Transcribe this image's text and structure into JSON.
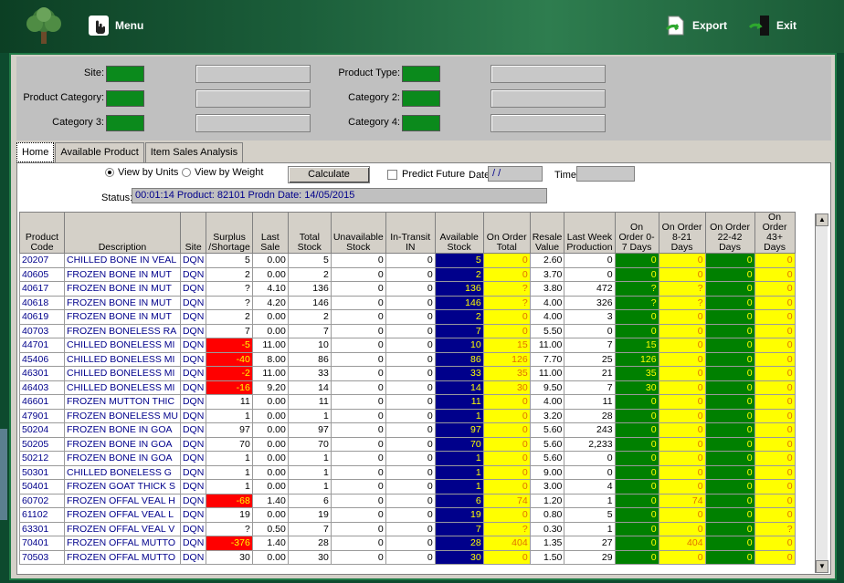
{
  "topbar": {
    "menu_label": "Menu",
    "export_label": "Export",
    "exit_label": "Exit"
  },
  "filters": {
    "site_label": "Site:",
    "product_category_label": "Product Category:",
    "category3_label": "Category 3:",
    "product_type_label": "Product Type:",
    "category2_label": "Category 2:",
    "category4_label": "Category 4:"
  },
  "tabs": [
    "Home",
    "Available Product",
    "Item Sales Analysis"
  ],
  "controls": {
    "view_units": "View by Units",
    "view_weight": "View by Weight",
    "calculate": "Calculate",
    "predict_future": "Predict Future",
    "date_label": "Date:",
    "date_value": " / /",
    "time_label": "Time:",
    "status_label": "Status:",
    "status_value": "00:01:14   Product: 82101   Prodn Date: 14/05/2015"
  },
  "table": {
    "headers": [
      "Product Code",
      "Description",
      "Site",
      "Surplus /Shortage",
      "Last Sale",
      "Total Stock",
      "Unavailable Stock",
      "In-Transit IN",
      "Available Stock",
      "On Order Total",
      "Resale Value",
      "Last Week Production",
      "On Order 0-7 Days",
      "On Order 8-21 Days",
      "On Order 22-42 Days",
      "On Order 43+ Days"
    ],
    "rows": [
      [
        "20207",
        "CHILLED BONE IN VEAL",
        "DQN",
        "5",
        "0.00",
        "5",
        "0",
        "0",
        "5",
        "0",
        "2.60",
        "0",
        "0",
        "0",
        "0",
        "0"
      ],
      [
        "40605",
        "FROZEN BONE IN MUT",
        "DQN",
        "2",
        "0.00",
        "2",
        "0",
        "0",
        "2",
        "0",
        "3.70",
        "0",
        "0",
        "0",
        "0",
        "0"
      ],
      [
        "40617",
        "FROZEN BONE IN MUT",
        "DQN",
        "?",
        "4.10",
        "136",
        "0",
        "0",
        "136",
        "?",
        "3.80",
        "472",
        "?",
        "?",
        "0",
        "0"
      ],
      [
        "40618",
        "FROZEN BONE IN MUT",
        "DQN",
        "?",
        "4.20",
        "146",
        "0",
        "0",
        "146",
        "?",
        "4.00",
        "326",
        "?",
        "?",
        "0",
        "0"
      ],
      [
        "40619",
        "FROZEN BONE IN MUT",
        "DQN",
        "2",
        "0.00",
        "2",
        "0",
        "0",
        "2",
        "0",
        "4.00",
        "3",
        "0",
        "0",
        "0",
        "0"
      ],
      [
        "40703",
        "FROZEN BONELESS RA",
        "DQN",
        "7",
        "0.00",
        "7",
        "0",
        "0",
        "7",
        "0",
        "5.50",
        "0",
        "0",
        "0",
        "0",
        "0"
      ],
      [
        "44701",
        "CHILLED BONELESS MI",
        "DQN",
        "-5",
        "11.00",
        "10",
        "0",
        "0",
        "10",
        "15",
        "11.00",
        "7",
        "15",
        "0",
        "0",
        "0"
      ],
      [
        "45406",
        "CHILLED BONELESS MI",
        "DQN",
        "-40",
        "8.00",
        "86",
        "0",
        "0",
        "86",
        "126",
        "7.70",
        "25",
        "126",
        "0",
        "0",
        "0"
      ],
      [
        "46301",
        "CHILLED BONELESS MI",
        "DQN",
        "-2",
        "11.00",
        "33",
        "0",
        "0",
        "33",
        "35",
        "11.00",
        "21",
        "35",
        "0",
        "0",
        "0"
      ],
      [
        "46403",
        "CHILLED BONELESS MI",
        "DQN",
        "-16",
        "9.20",
        "14",
        "0",
        "0",
        "14",
        "30",
        "9.50",
        "7",
        "30",
        "0",
        "0",
        "0"
      ],
      [
        "46601",
        "FROZEN MUTTON THIC",
        "DQN",
        "11",
        "0.00",
        "11",
        "0",
        "0",
        "11",
        "0",
        "4.00",
        "11",
        "0",
        "0",
        "0",
        "0"
      ],
      [
        "47901",
        "FROZEN BONELESS MU",
        "DQN",
        "1",
        "0.00",
        "1",
        "0",
        "0",
        "1",
        "0",
        "3.20",
        "28",
        "0",
        "0",
        "0",
        "0"
      ],
      [
        "50204",
        "FROZEN BONE IN GOA",
        "DQN",
        "97",
        "0.00",
        "97",
        "0",
        "0",
        "97",
        "0",
        "5.60",
        "243",
        "0",
        "0",
        "0",
        "0"
      ],
      [
        "50205",
        "FROZEN BONE IN GOA",
        "DQN",
        "70",
        "0.00",
        "70",
        "0",
        "0",
        "70",
        "0",
        "5.60",
        "2,233",
        "0",
        "0",
        "0",
        "0"
      ],
      [
        "50212",
        "FROZEN BONE IN GOA",
        "DQN",
        "1",
        "0.00",
        "1",
        "0",
        "0",
        "1",
        "0",
        "5.60",
        "0",
        "0",
        "0",
        "0",
        "0"
      ],
      [
        "50301",
        "CHILLED BONELESS G",
        "DQN",
        "1",
        "0.00",
        "1",
        "0",
        "0",
        "1",
        "0",
        "9.00",
        "0",
        "0",
        "0",
        "0",
        "0"
      ],
      [
        "50401",
        "FROZEN GOAT THICK S",
        "DQN",
        "1",
        "0.00",
        "1",
        "0",
        "0",
        "1",
        "0",
        "3.00",
        "4",
        "0",
        "0",
        "0",
        "0"
      ],
      [
        "60702",
        "FROZEN OFFAL VEAL H",
        "DQN",
        "-68",
        "1.40",
        "6",
        "0",
        "0",
        "6",
        "74",
        "1.20",
        "1",
        "0",
        "74",
        "0",
        "0"
      ],
      [
        "61102",
        "FROZEN OFFAL VEAL L",
        "DQN",
        "19",
        "0.00",
        "19",
        "0",
        "0",
        "19",
        "0",
        "0.80",
        "5",
        "0",
        "0",
        "0",
        "0"
      ],
      [
        "63301",
        "FROZEN OFFAL VEAL V",
        "DQN",
        "?",
        "0.50",
        "7",
        "0",
        "0",
        "7",
        "?",
        "0.30",
        "1",
        "0",
        "0",
        "0",
        "?"
      ],
      [
        "70401",
        "FROZEN OFFAL MUTTO",
        "DQN",
        "-376",
        "1.40",
        "28",
        "0",
        "0",
        "28",
        "404",
        "1.35",
        "27",
        "0",
        "404",
        "0",
        "0"
      ],
      [
        "70503",
        "FROZEN OFFAL MUTTO",
        "DQN",
        "30",
        "0.00",
        "30",
        "0",
        "0",
        "30",
        "0",
        "1.50",
        "29",
        "0",
        "0",
        "0",
        "0"
      ]
    ]
  }
}
